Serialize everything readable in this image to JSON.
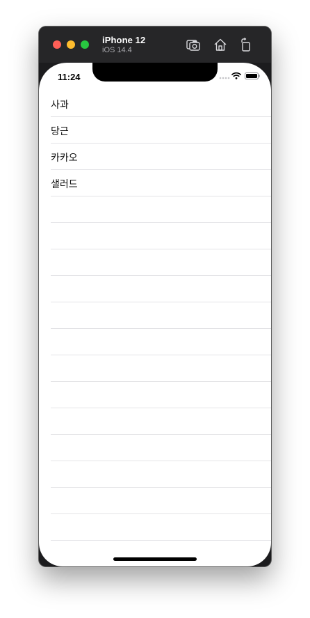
{
  "simulator": {
    "device_name": "iPhone 12",
    "os_version": "iOS 14.4",
    "toolbar_icons": [
      "screenshot-icon",
      "home-icon",
      "rotate-icon"
    ]
  },
  "status_bar": {
    "time": "11:24",
    "icons": [
      "cellular-signal-icon",
      "wifi-icon",
      "battery-icon"
    ]
  },
  "list": {
    "items": [
      {
        "label": "사과"
      },
      {
        "label": "당근"
      },
      {
        "label": "카카오"
      },
      {
        "label": "샐러드"
      }
    ],
    "empty_rows": 14
  },
  "colors": {
    "close": "#ff5f57",
    "minimize": "#febc2e",
    "zoom": "#28c840",
    "separator": "#e3e3e6"
  }
}
